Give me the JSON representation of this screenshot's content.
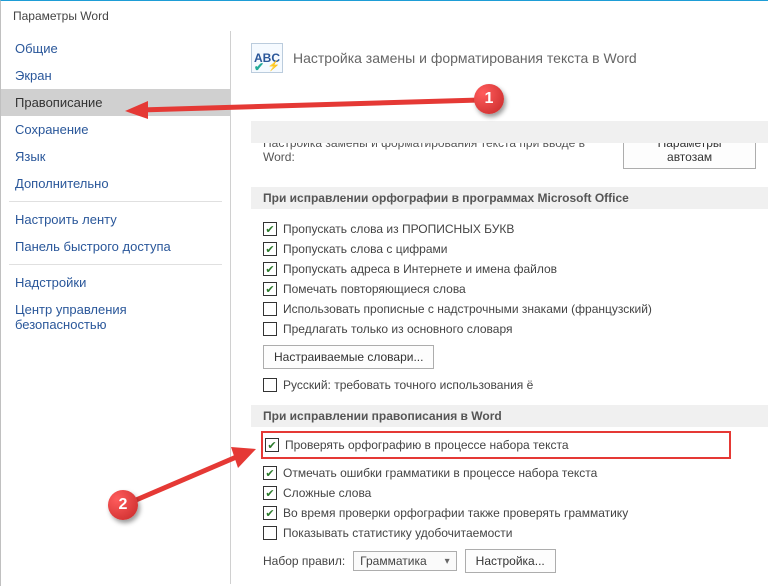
{
  "window": {
    "title": "Параметры Word"
  },
  "sidebar": {
    "items": [
      {
        "label": "Общие"
      },
      {
        "label": "Экран"
      },
      {
        "label": "Правописание"
      },
      {
        "label": "Сохранение"
      },
      {
        "label": "Язык"
      },
      {
        "label": "Дополнительно"
      },
      {
        "label": "Настроить ленту"
      },
      {
        "label": "Панель быстрого доступа"
      },
      {
        "label": "Надстройки"
      },
      {
        "label": "Центр управления безопасностью"
      }
    ]
  },
  "header": {
    "icon_text": "ABC",
    "text": "Настройка замены и форматирования текста в Word"
  },
  "autocorrect": {
    "subtext": "Настройка замены и форматирования текста при вводе в Word:",
    "button": "Параметры автозам"
  },
  "spelling_office": {
    "title": "При исправлении орфографии в программах Microsoft Office",
    "checks": [
      {
        "label": "Пропускать слова из ПРОПИСНЫХ БУКВ",
        "checked": true
      },
      {
        "label": "Пропускать слова с цифрами",
        "checked": true
      },
      {
        "label": "Пропускать адреса в Интернете и имена файлов",
        "checked": true
      },
      {
        "label": "Помечать повторяющиеся слова",
        "checked": true
      },
      {
        "label": "Использовать прописные с надстрочными знаками (французский)",
        "checked": false
      },
      {
        "label": "Предлагать только из основного словаря",
        "checked": false
      }
    ],
    "dict_button": "Настраиваемые словари...",
    "russian": {
      "label": "Русский: требовать точного использования ё",
      "checked": false
    }
  },
  "spelling_word": {
    "title": "При исправлении правописания в Word",
    "highlighted": {
      "label": "Проверять орфографию в процессе набора текста",
      "checked": true
    },
    "checks": [
      {
        "label": "Отмечать ошибки грамматики в процессе набора текста",
        "checked": true
      },
      {
        "label": "Сложные слова",
        "checked": true
      },
      {
        "label": "Во время проверки орфографии также проверять грамматику",
        "checked": true
      },
      {
        "label": "Показывать статистику удобочитаемости",
        "checked": false
      }
    ],
    "ruleset_label": "Набор правил:",
    "ruleset_value": "Грамматика",
    "settings_button": "Настройка..."
  },
  "callouts": {
    "c1": "1",
    "c2": "2"
  }
}
